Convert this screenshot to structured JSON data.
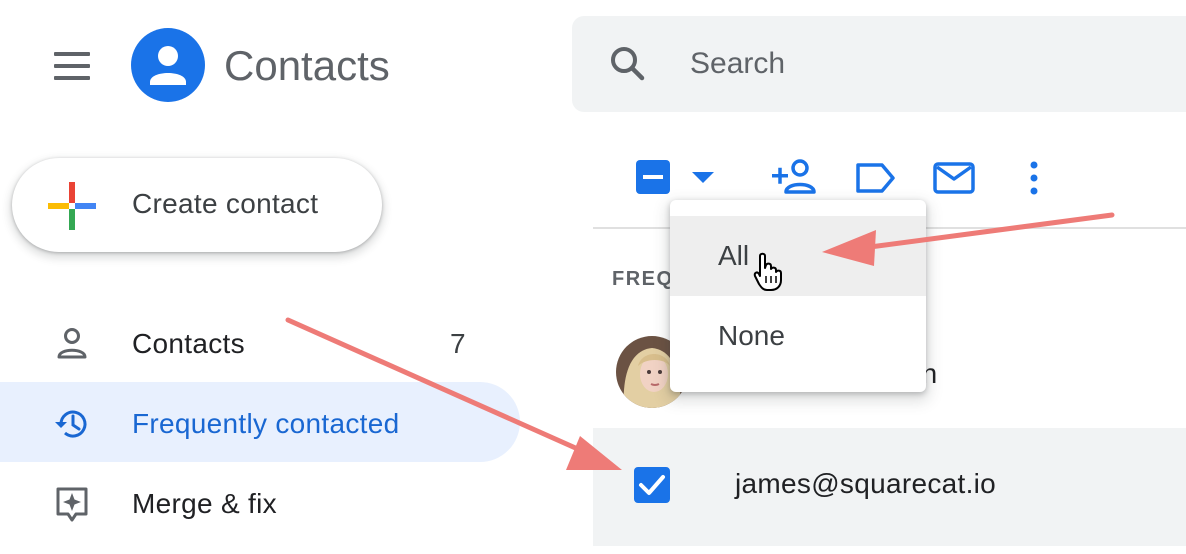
{
  "header": {
    "app_title": "Contacts",
    "search_placeholder": "Search"
  },
  "sidebar": {
    "create_label": "Create contact",
    "items": [
      {
        "label": "Contacts",
        "count": "7",
        "icon": "person-icon",
        "active": false
      },
      {
        "label": "Frequently contacted",
        "icon": "history-icon",
        "active": true
      },
      {
        "label": "Merge & fix",
        "icon": "merge-fix-icon",
        "active": false
      }
    ]
  },
  "toolbar": {
    "icons": [
      "select-partial-checkbox-icon",
      "select-dropdown-arrow-icon",
      "add-person-icon",
      "label-icon",
      "email-icon",
      "more-vert-icon"
    ]
  },
  "list": {
    "section_header": "FREQ",
    "rows": [
      {
        "name_visible": "on",
        "has_avatar": true,
        "selected": false
      },
      {
        "email": "james@squarecat.io",
        "selected": true
      }
    ]
  },
  "select_dropdown": {
    "options": [
      "All",
      "None"
    ],
    "hovered": "All"
  },
  "annotations": {
    "arrow_color": "#ee7b77"
  },
  "colors": {
    "accent": "#1a73e8",
    "active_nav_bg": "#e8f0fe",
    "active_nav_text": "#1967d2"
  }
}
